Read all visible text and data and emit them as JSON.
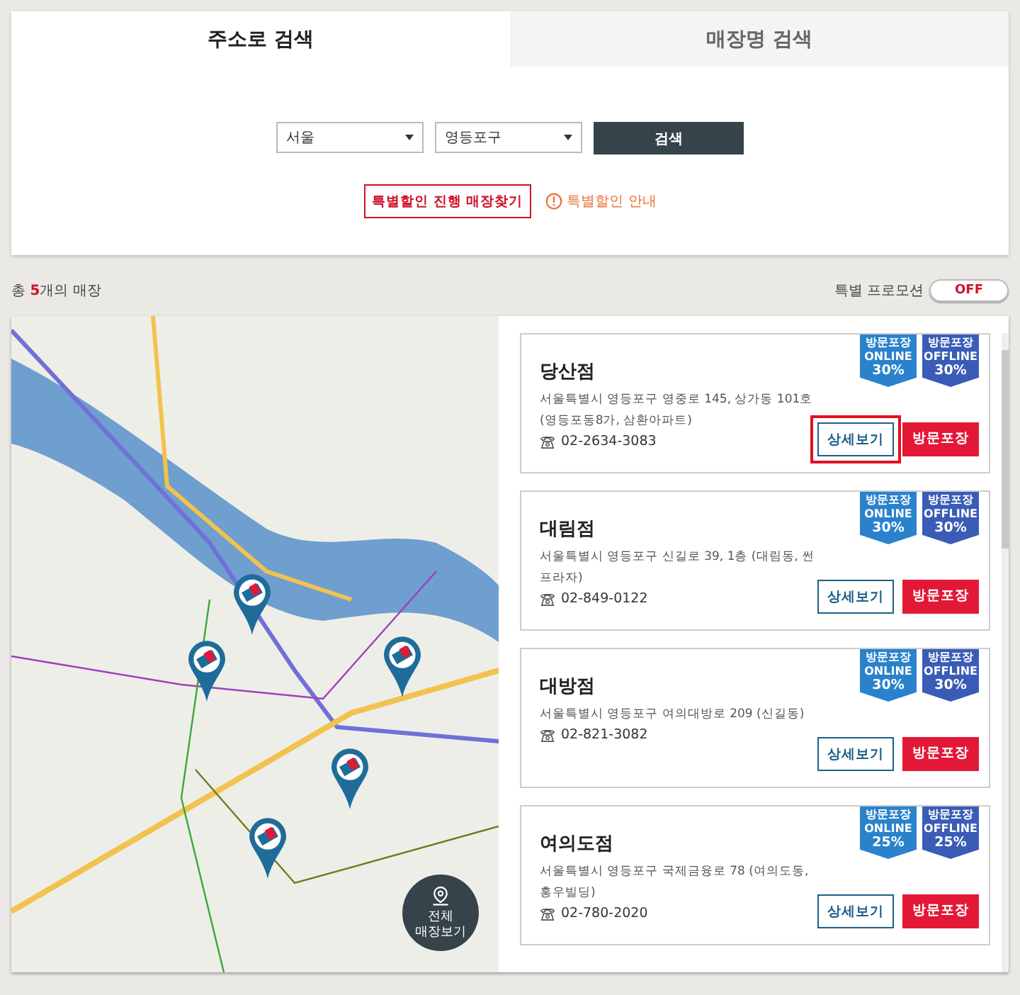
{
  "tabs": [
    {
      "label": "주소로 검색",
      "selected": true
    },
    {
      "label": "매장명 검색",
      "selected": false
    }
  ],
  "search": {
    "city": "서울",
    "district": "영등포구",
    "button": "검색"
  },
  "promo_links": {
    "find_button": "특별할인 진행 매장찾기",
    "info_link": "특별할인 안내"
  },
  "summary": {
    "prefix": "총 ",
    "count": "5",
    "suffix": "개의 매장"
  },
  "promotion_toggle": {
    "label": "특별 프로모션",
    "value": "OFF",
    "on": false
  },
  "map": {
    "all_stores_button": "전체 매장보기"
  },
  "stores": [
    {
      "name": "당산점",
      "address": "서울특별시 영등포구 영중로 145, 상가동 101호 (영등포동8가, 삼환아파트)",
      "phone": "02-2634-3083",
      "badges": [
        {
          "kind": "online",
          "top": "방문포장",
          "mid": "ONLINE",
          "pct": "30%"
        },
        {
          "kind": "offline",
          "top": "방문포장",
          "mid": "OFFLINE",
          "pct": "30%"
        }
      ],
      "detail_button": "상세보기",
      "pickup_button": "방문포장",
      "highlighted": true
    },
    {
      "name": "대림점",
      "address": "서울특별시 영등포구 신길로 39, 1층 (대림동, 썬프라자)",
      "phone": "02-849-0122",
      "badges": [
        {
          "kind": "online",
          "top": "방문포장",
          "mid": "ONLINE",
          "pct": "30%"
        },
        {
          "kind": "offline",
          "top": "방문포장",
          "mid": "OFFLINE",
          "pct": "30%"
        }
      ],
      "detail_button": "상세보기",
      "pickup_button": "방문포장",
      "highlighted": false
    },
    {
      "name": "대방점",
      "address": "서울특별시 영등포구 여의대방로 209 (신길동)",
      "phone": "02-821-3082",
      "badges": [
        {
          "kind": "online",
          "top": "방문포장",
          "mid": "ONLINE",
          "pct": "30%"
        },
        {
          "kind": "offline",
          "top": "방문포장",
          "mid": "OFFLINE",
          "pct": "30%"
        }
      ],
      "detail_button": "상세보기",
      "pickup_button": "방문포장",
      "highlighted": false
    },
    {
      "name": "여의도점",
      "address": "서울특별시 영등포구 국제금융로 78 (여의도동, 홍우빌딩)",
      "phone": "02-780-2020",
      "badges": [
        {
          "kind": "online",
          "top": "방문포장",
          "mid": "ONLINE",
          "pct": "25%"
        },
        {
          "kind": "offline",
          "top": "방문포장",
          "mid": "OFFLINE",
          "pct": "25%"
        }
      ],
      "detail_button": "상세보기",
      "pickup_button": "방문포장",
      "highlighted": false
    }
  ]
}
